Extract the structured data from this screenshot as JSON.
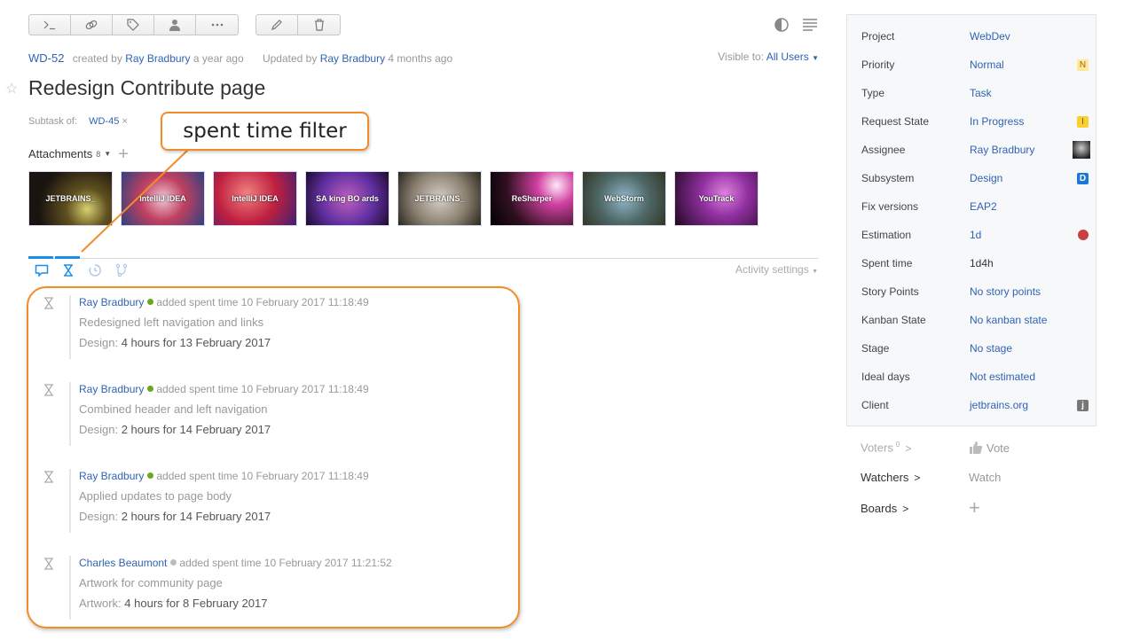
{
  "toolbar": {
    "group1": [
      {
        "name": "command-icon",
        "label": "Command"
      },
      {
        "name": "link-icon",
        "label": "Link issue"
      },
      {
        "name": "tag-icon",
        "label": "Tag"
      },
      {
        "name": "user-icon",
        "label": "Assign"
      },
      {
        "name": "more-icon",
        "label": "More"
      }
    ],
    "group2": [
      {
        "name": "edit-icon",
        "label": "Edit"
      },
      {
        "name": "delete-icon",
        "label": "Delete"
      }
    ],
    "right_icons": [
      "contrast-icon",
      "menu-lines-icon"
    ]
  },
  "issue": {
    "id": "WD-52",
    "created_prefix": "created by",
    "created_by": "Ray Bradbury",
    "created_when": "a year ago",
    "updated_prefix": "Updated by",
    "updated_by": "Ray Bradbury",
    "updated_when": "4 months ago",
    "visible_label": "Visible to:",
    "visible_value": "All Users",
    "title": "Redesign Contribute page",
    "subtask_label": "Subtask of:",
    "subtask_value": "WD-45",
    "attachments_label": "Attachments",
    "attachments_count": "8"
  },
  "attachments": [
    {
      "label": "JETBRAINS_"
    },
    {
      "label": "IntelliJ IDEA"
    },
    {
      "label": "IntelliJ IDEA"
    },
    {
      "label": "SA king BO ards"
    },
    {
      "label": "JETBRAINS_"
    },
    {
      "label": "ReSharper"
    },
    {
      "label": "WebStorm"
    },
    {
      "label": "YouTrack"
    }
  ],
  "activity": {
    "tabs": [
      {
        "name": "comments-tab",
        "icon": "comment-icon",
        "active": true
      },
      {
        "name": "spent-time-tab",
        "icon": "hourglass-icon",
        "active": true
      },
      {
        "name": "history-tab",
        "icon": "history-icon",
        "active": false
      },
      {
        "name": "vcs-tab",
        "icon": "vcs-branch-icon",
        "active": false
      }
    ],
    "settings_label": "Activity settings",
    "entries": [
      {
        "author": "Ray Bradbury",
        "online": true,
        "action": "added spent time 10 February 2017 11:18:49",
        "description": "Redesigned left navigation and links",
        "work_type": "Design:",
        "work_value": "4 hours for 13 February 2017"
      },
      {
        "author": "Ray Bradbury",
        "online": true,
        "action": "added spent time 10 February 2017 11:18:49",
        "description": "Combined header and left navigation",
        "work_type": "Design:",
        "work_value": "2 hours for 14 February 2017"
      },
      {
        "author": "Ray Bradbury",
        "online": true,
        "action": "added spent time 10 February 2017 11:18:49",
        "description": "Applied updates to page body",
        "work_type": "Design:",
        "work_value": "2 hours for 14 February 2017"
      },
      {
        "author": "Charles Beaumont",
        "online": false,
        "action": "added spent time 10 February 2017 11:21:52",
        "description": "Artwork for community page",
        "work_type": "Artwork:",
        "work_value": "4 hours for 8 February 2017"
      }
    ]
  },
  "fields": [
    {
      "key": "Project",
      "value": "WebDev",
      "badge": ""
    },
    {
      "key": "Priority",
      "value": "Normal",
      "badge": "N"
    },
    {
      "key": "Type",
      "value": "Task",
      "badge": ""
    },
    {
      "key": "Request State",
      "value": "In Progress",
      "badge": "I"
    },
    {
      "key": "Assignee",
      "value": "Ray Bradbury",
      "badge": "avatar"
    },
    {
      "key": "Subsystem",
      "value": "Design",
      "badge": "D"
    },
    {
      "key": "Fix versions",
      "value": "EAP2",
      "badge": ""
    },
    {
      "key": "Estimation",
      "value": "1d",
      "badge": "dot"
    },
    {
      "key": "Spent time",
      "value": "1d4h",
      "badge": ""
    },
    {
      "key": "Story Points",
      "value": "No story points",
      "badge": ""
    },
    {
      "key": "Kanban State",
      "value": "No kanban state",
      "badge": ""
    },
    {
      "key": "Stage",
      "value": "No stage",
      "badge": ""
    },
    {
      "key": "Ideal days",
      "value": "Not estimated",
      "badge": ""
    },
    {
      "key": "Client",
      "value": "jetbrains.org",
      "badge": "j"
    }
  ],
  "side": {
    "voters_label": "Voters",
    "voters_count": "0",
    "vote_label": "Vote",
    "watchers_label": "Watchers",
    "watch_label": "Watch",
    "boards_label": "Boards"
  },
  "annotation": {
    "callout_text": "spent time filter",
    "color": "#f28c28"
  }
}
